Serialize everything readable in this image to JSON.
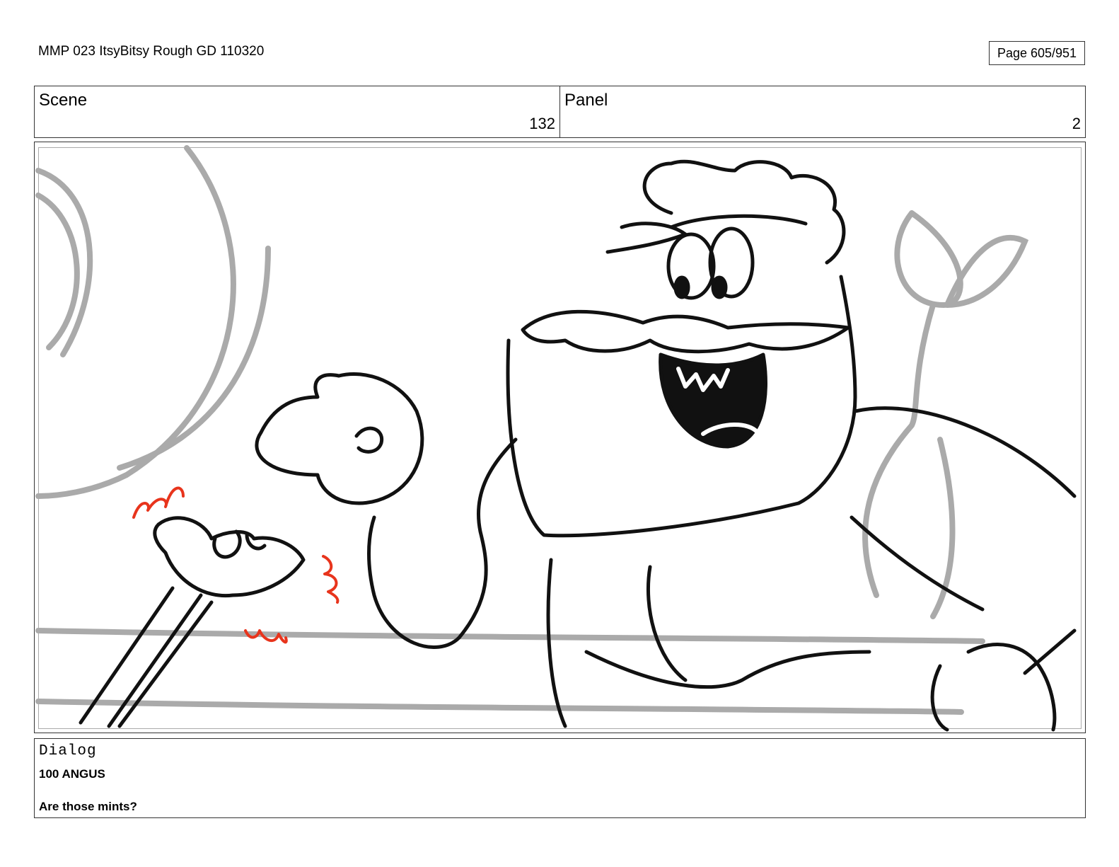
{
  "document": {
    "title": "MMP 023 ItsyBitsy Rough GD 110320",
    "page_indicator": "Page 605/951"
  },
  "header": {
    "scene_label": "Scene",
    "scene_value": "132",
    "panel_label": "Panel",
    "panel_value": "2"
  },
  "dialog": {
    "label": "Dialog",
    "speaker": "100 ANGUS",
    "line": "Are those mints?"
  },
  "colors": {
    "ink": "#111111",
    "rough": "#aaaaaa",
    "accent": "#e8341c"
  }
}
